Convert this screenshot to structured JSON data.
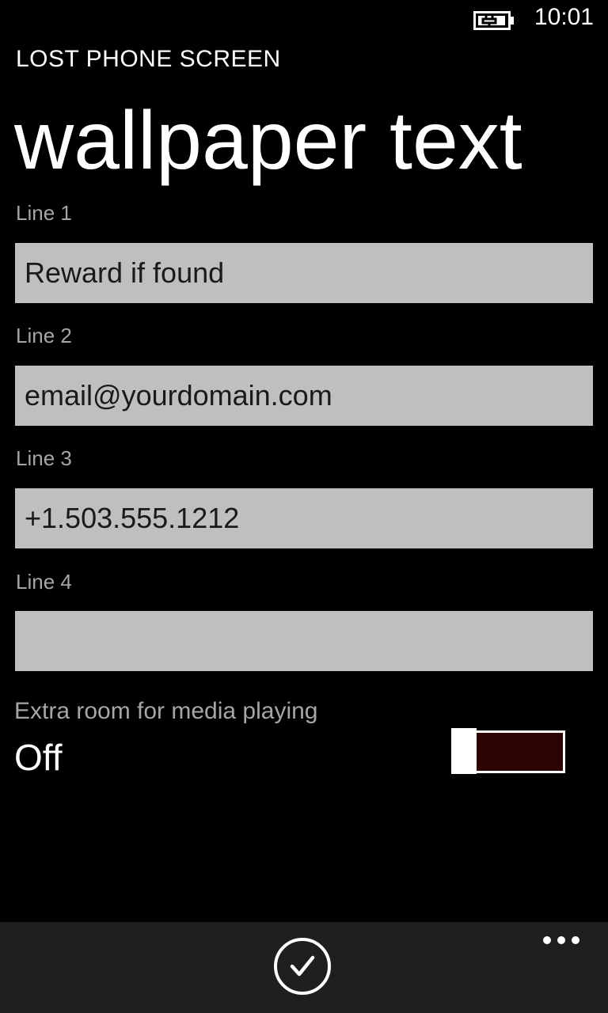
{
  "status_bar": {
    "time": "10:01",
    "battery_icon": "battery-charging-icon"
  },
  "app_title": "LOST PHONE SCREEN",
  "page_title": "wallpaper text",
  "fields": [
    {
      "label": "Line 1",
      "value": "Reward if found"
    },
    {
      "label": "Line 2",
      "value": "email@yourdomain.com"
    },
    {
      "label": "Line 3",
      "value": "+1.503.555.1212"
    },
    {
      "label": "Line 4",
      "value": ""
    }
  ],
  "toggle": {
    "label": "Extra room for media playing",
    "state": "Off",
    "on": false,
    "track_color": "#2e0303"
  },
  "app_bar": {
    "primary_icon": "check-icon",
    "more_icon": "more-icon"
  },
  "colors": {
    "background": "#000000",
    "textbox": "#bfbfbf",
    "label": "#a6a6a6",
    "appbar": "#1f1f1f"
  }
}
